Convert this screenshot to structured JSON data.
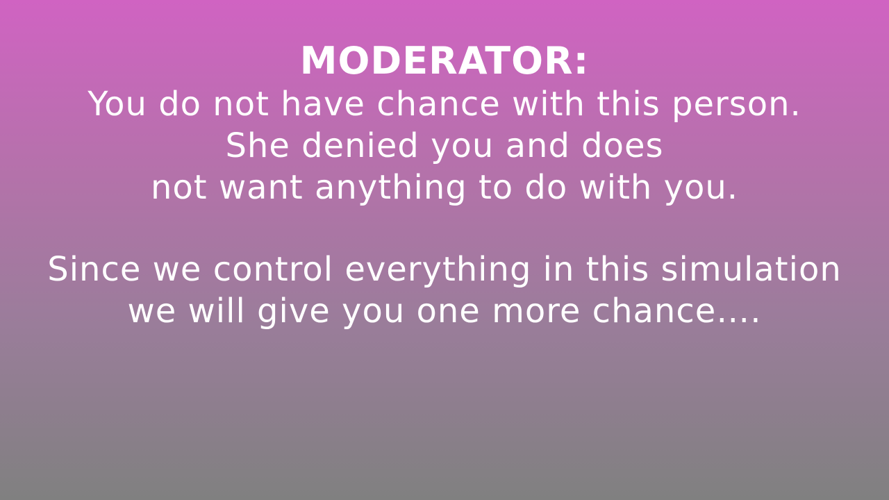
{
  "slide": {
    "title": "MODERATOR:",
    "paragraph1": [
      "You do not have chance with this person.",
      "She denied you and does",
      "not want anything to do with you."
    ],
    "paragraph2": [
      "Since we control everything in this simulation",
      "we will give you one more chance…."
    ]
  },
  "colors": {
    "gradient_top": "#d063c2",
    "gradient_bottom": "#808080",
    "text": "#ffffff"
  }
}
